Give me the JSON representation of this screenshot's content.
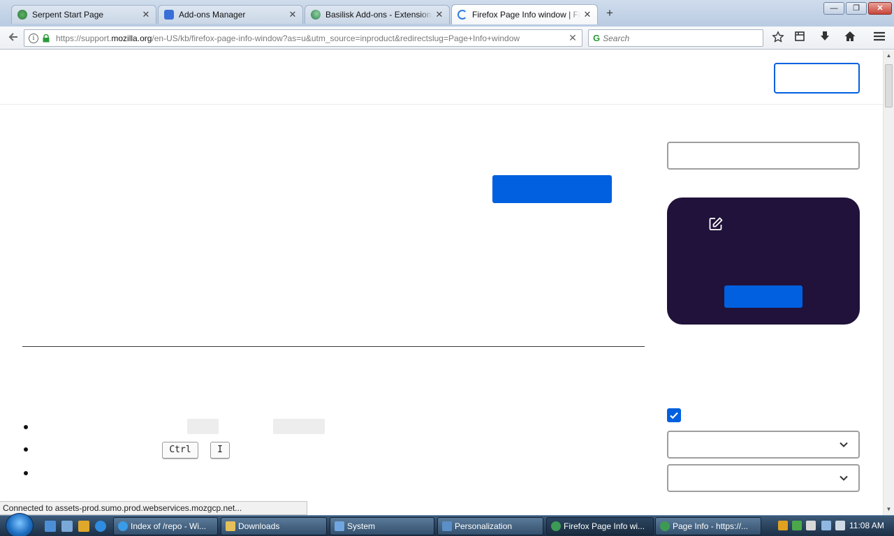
{
  "tabs": [
    {
      "title": "Serpent Start Page",
      "close": "✕"
    },
    {
      "title": "Add-ons Manager",
      "close": "✕"
    },
    {
      "title": "Basilisk Add-ons - Extensions",
      "close": "✕"
    },
    {
      "title": "Firefox Page Info window | Firefox Help",
      "close": "✕"
    }
  ],
  "new_tab_label": "+",
  "window_controls": {
    "minimize": "—",
    "restore": "❐",
    "close": "✕"
  },
  "navbar": {
    "url_prefix": "https://support.",
    "url_domain": "mozilla.org",
    "url_rest": "/en-US/kb/firefox-page-info-window?as=u&utm_source=inproduct&redirectslug=Page+Info+window",
    "clear_label": "✕",
    "search_placeholder": "Search"
  },
  "page": {
    "kbd_ctrl": "Ctrl",
    "kbd_i": "I"
  },
  "status_text": "Connected to assets-prod.sumo.prod.webservices.mozgcp.net...",
  "taskbar": {
    "items": [
      {
        "label": "Index of /repo - Wi..."
      },
      {
        "label": "Downloads"
      },
      {
        "label": "System"
      },
      {
        "label": "Personalization"
      },
      {
        "label": "Firefox Page Info wi..."
      },
      {
        "label": "Page Info - https://..."
      }
    ],
    "clock": "11:08 AM"
  },
  "colors": {
    "accent": "#0060df",
    "promo_bg": "#20123a"
  }
}
